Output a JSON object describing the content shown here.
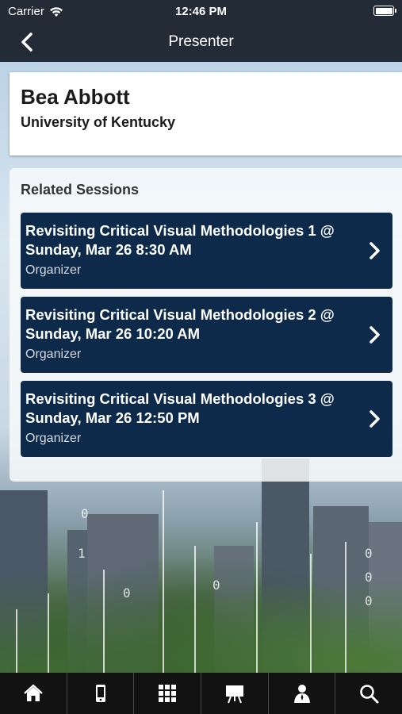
{
  "status_bar": {
    "carrier": "Carrier",
    "time": "12:46 PM"
  },
  "nav": {
    "title": "Presenter",
    "back_icon": "chevron-left-icon"
  },
  "presenter": {
    "name": "Bea Abbott",
    "organization": "University of Kentucky"
  },
  "related": {
    "heading": "Related Sessions",
    "sessions": [
      {
        "title": "Revisiting Critical Visual Methodologies 1 @ Sunday, Mar 26 8:30 AM",
        "role": "Organizer"
      },
      {
        "title": "Revisiting Critical Visual Methodologies 2 @ Sunday, Mar 26 10:20 AM",
        "role": "Organizer"
      },
      {
        "title": "Revisiting Critical Visual Methodologies 3 @ Sunday, Mar 26 12:50 PM",
        "role": "Organizer"
      }
    ]
  },
  "tabbar": {
    "tabs": [
      {
        "icon": "home-icon"
      },
      {
        "icon": "phone-icon"
      },
      {
        "icon": "grid-icon"
      },
      {
        "icon": "presentation-icon"
      },
      {
        "icon": "person-icon"
      },
      {
        "icon": "search-icon"
      }
    ]
  },
  "colors": {
    "header": "#232b36",
    "session_bg": "#0d2a4a",
    "tabbar": "#121212"
  }
}
